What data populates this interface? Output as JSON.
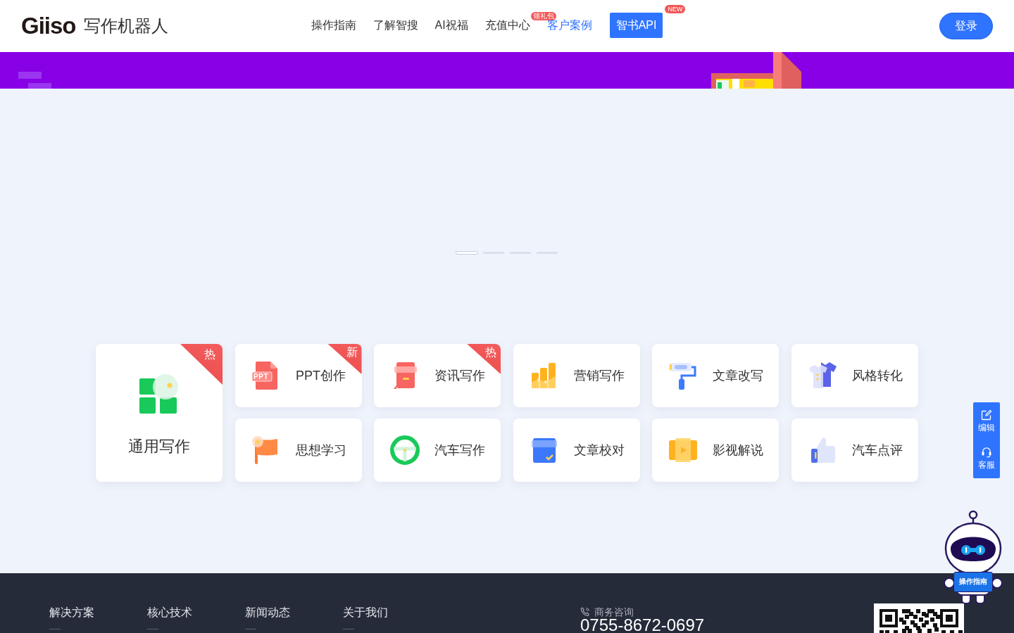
{
  "header": {
    "logo": {
      "wordmark": "Giiso",
      "product": "写作机器人"
    },
    "nav": [
      {
        "label": "操作指南",
        "kind": "link",
        "selected": false
      },
      {
        "label": "了解智搜",
        "kind": "link",
        "selected": false
      },
      {
        "label": "AI祝福",
        "kind": "link",
        "selected": false
      },
      {
        "label": "充值中心",
        "kind": "link",
        "selected": false,
        "badge": "领礼包"
      },
      {
        "label": "客户案例",
        "kind": "link",
        "selected": true
      },
      {
        "label": "智书API",
        "kind": "button",
        "selected": false,
        "badge": "NEW"
      }
    ],
    "login_button": "登录"
  },
  "carousel": {
    "dots": [
      {
        "selected": true
      },
      {
        "selected": false
      },
      {
        "selected": false
      },
      {
        "selected": false
      }
    ]
  },
  "tools": [
    {
      "label": "通用写作",
      "kind": "large",
      "badge": "热"
    },
    {
      "label": "PPT创作",
      "kind": "small",
      "badge": "新",
      "icon_text": "PPT"
    },
    {
      "label": "资讯写作",
      "kind": "small",
      "badge": "热"
    },
    {
      "label": "营销写作",
      "kind": "small"
    },
    {
      "label": "文章改写",
      "kind": "small"
    },
    {
      "label": "风格转化",
      "kind": "small"
    },
    {
      "label": "思想学习",
      "kind": "small"
    },
    {
      "label": "汽车写作",
      "kind": "small"
    },
    {
      "label": "文章校对",
      "kind": "small"
    },
    {
      "label": "影视解说",
      "kind": "small"
    },
    {
      "label": "汽车点评",
      "kind": "small"
    }
  ],
  "side_tools": [
    {
      "label": "编辑"
    },
    {
      "label": "客服"
    }
  ],
  "assistant": {
    "label": "操作指南"
  },
  "footer": {
    "links": [
      "解决方案",
      "核心技术",
      "新闻动态",
      "关于我们"
    ],
    "contact": {
      "label": "商务咨询",
      "phone": "0755-8672-0697"
    }
  }
}
